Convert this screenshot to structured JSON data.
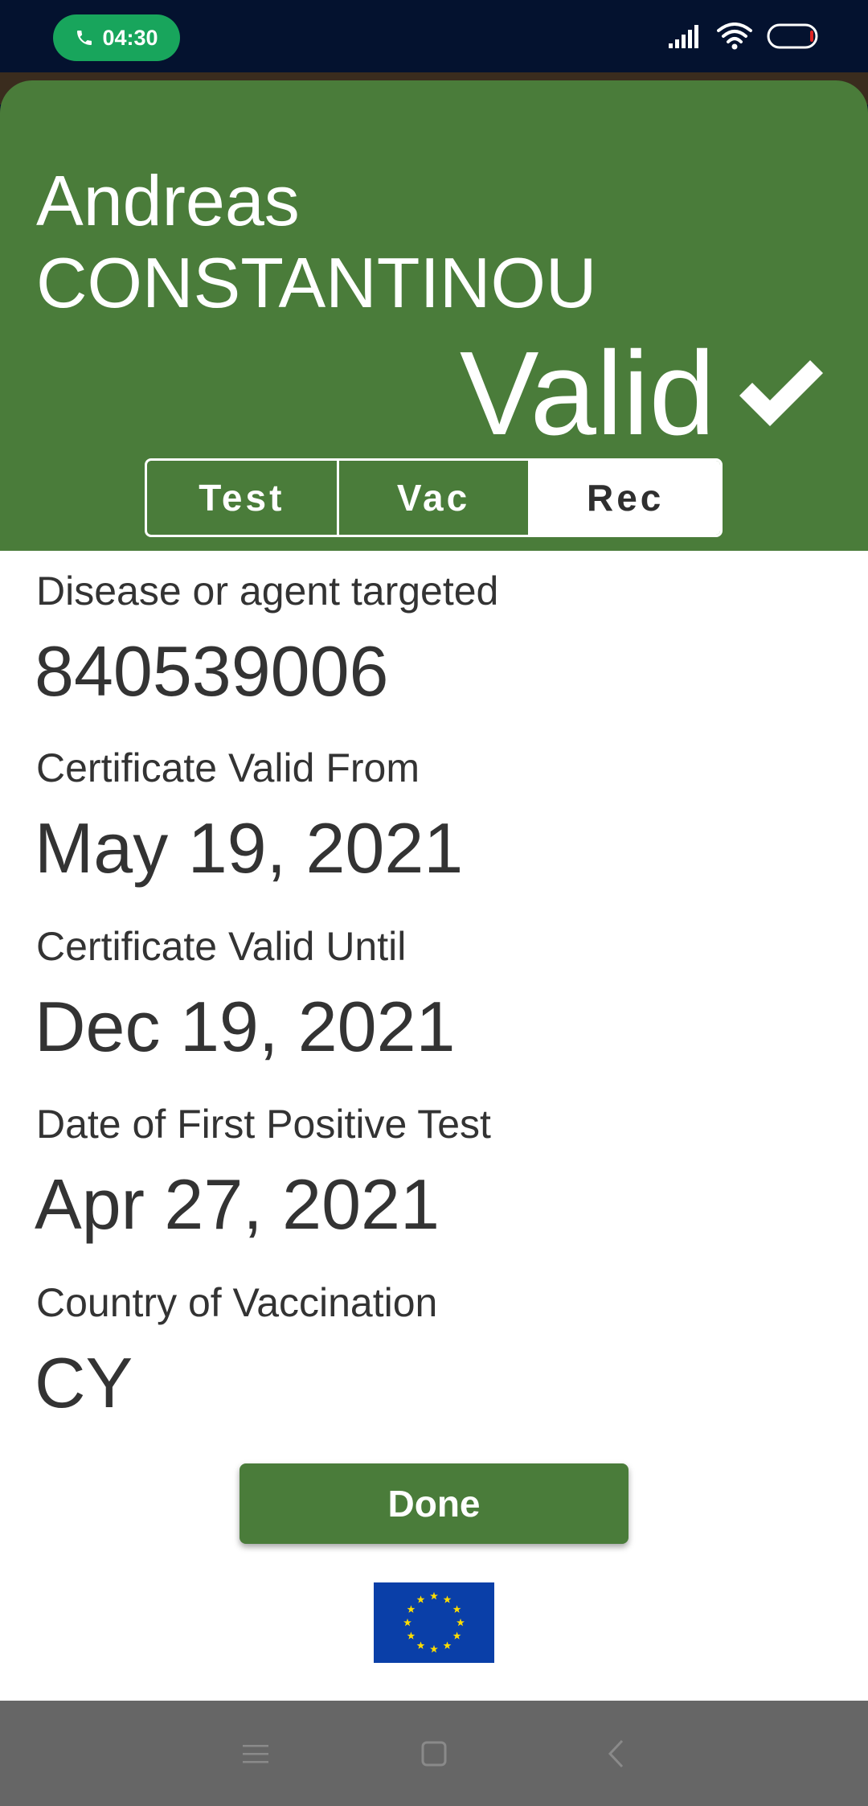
{
  "status_bar": {
    "call_time": "04:30",
    "icons": [
      "phone-icon",
      "signal-icon",
      "wifi-icon",
      "battery-icon"
    ]
  },
  "person": {
    "first_name": "Andreas",
    "last_name": "CONSTANTINOU"
  },
  "status": {
    "label": "Valid",
    "icon": "checkmark-icon"
  },
  "tabs": [
    {
      "label": "Test",
      "active": false
    },
    {
      "label": "Vac",
      "active": false
    },
    {
      "label": "Rec",
      "active": true
    }
  ],
  "fields": [
    {
      "label": "Disease or agent targeted",
      "value": "840539006"
    },
    {
      "label": "Certificate Valid From",
      "value": "May 19, 2021"
    },
    {
      "label": "Certificate Valid Until",
      "value": "Dec 19, 2021"
    },
    {
      "label": "Date of First Positive Test",
      "value": "Apr 27, 2021"
    },
    {
      "label": "Country of Vaccination",
      "value": "CY"
    }
  ],
  "done_label": "Done",
  "footer": {
    "flag": "eu-flag-icon"
  },
  "nav_bar": {
    "buttons": [
      "menu-icon",
      "home-icon",
      "back-icon"
    ]
  },
  "colors": {
    "header_green": "#4a7c3a",
    "status_bar_bg": "#04122f",
    "call_pill": "#18a55c",
    "text_dark": "#333333",
    "nav_bar_bg": "#666666",
    "eu_blue": "#0a3fa8",
    "eu_star": "#ffdd00"
  }
}
